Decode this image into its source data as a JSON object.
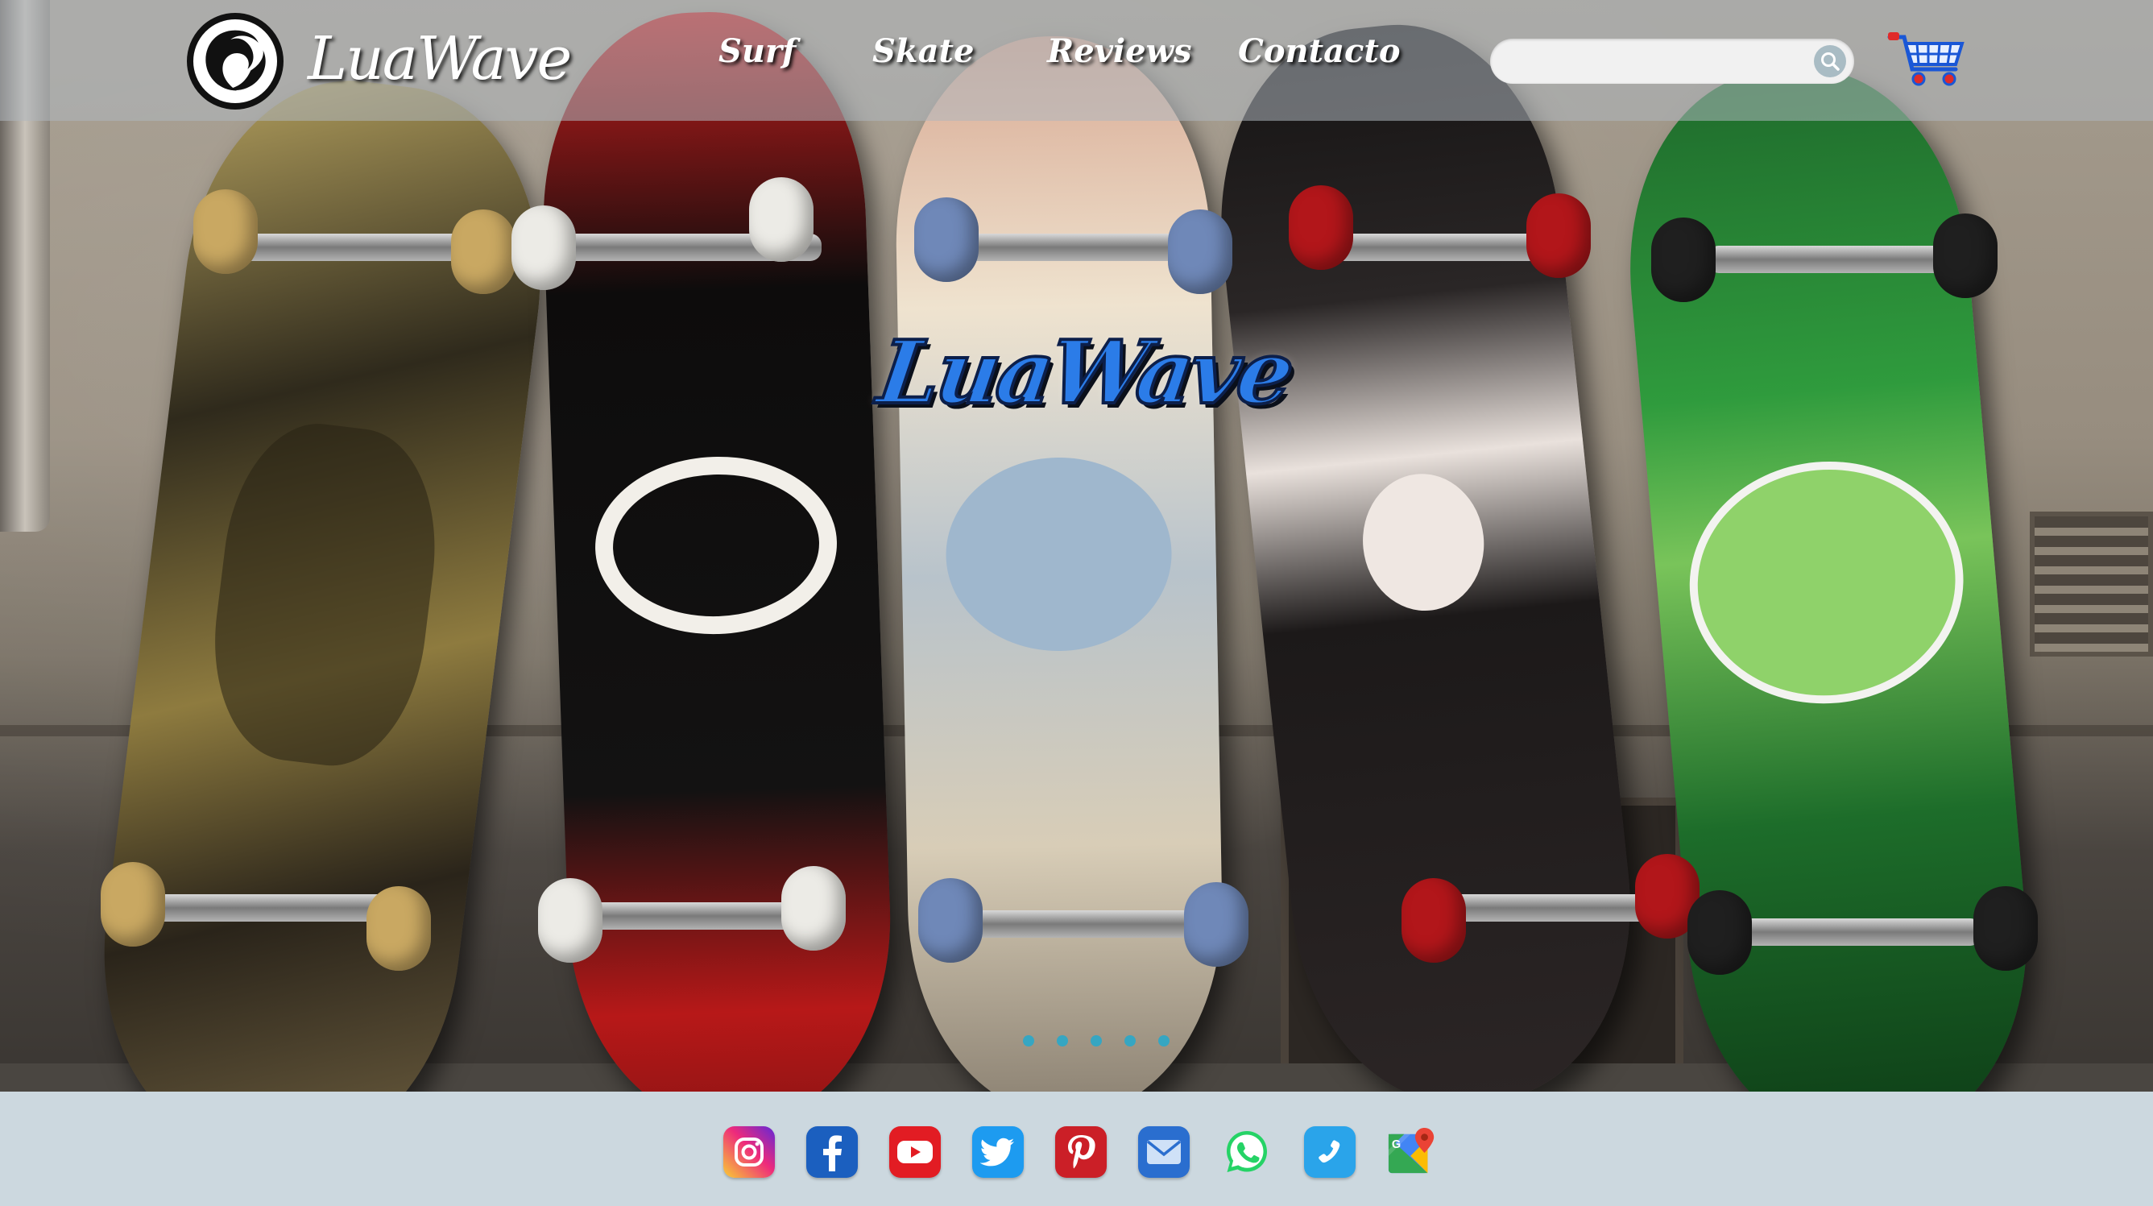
{
  "brand": {
    "name": "LuaWave"
  },
  "hero": {
    "title": "LuaWave",
    "slide_count": 5,
    "active_slide": 1
  },
  "nav": {
    "items": [
      {
        "label": "Surf"
      },
      {
        "label": "Skate"
      },
      {
        "label": "Reviews"
      },
      {
        "label": "Contacto"
      }
    ]
  },
  "search": {
    "value": "",
    "placeholder": "",
    "icon": "search-icon"
  },
  "cart": {
    "icon": "shopping-cart-icon"
  },
  "social": [
    {
      "name": "instagram",
      "icon": "instagram-icon",
      "color": "#c13584"
    },
    {
      "name": "facebook",
      "icon": "facebook-icon",
      "color": "#1877f2"
    },
    {
      "name": "youtube",
      "icon": "youtube-icon",
      "color": "#e52d27"
    },
    {
      "name": "twitter",
      "icon": "twitter-icon",
      "color": "#1da1f2"
    },
    {
      "name": "pinterest",
      "icon": "pinterest-icon",
      "color": "#c8232c"
    },
    {
      "name": "email",
      "icon": "mail-icon",
      "color": "#3b86d9"
    },
    {
      "name": "whatsapp",
      "icon": "whatsapp-icon",
      "color": "#25d366"
    },
    {
      "name": "phone",
      "icon": "phone-icon",
      "color": "#1e9de0"
    },
    {
      "name": "maps",
      "icon": "google-maps-icon",
      "color": "#34a853"
    }
  ],
  "colors": {
    "accent": "#2b7ce8",
    "header_overlay": "#afb6be",
    "footer_bg": "#ccd8df",
    "dot": "#2aa7c9"
  }
}
